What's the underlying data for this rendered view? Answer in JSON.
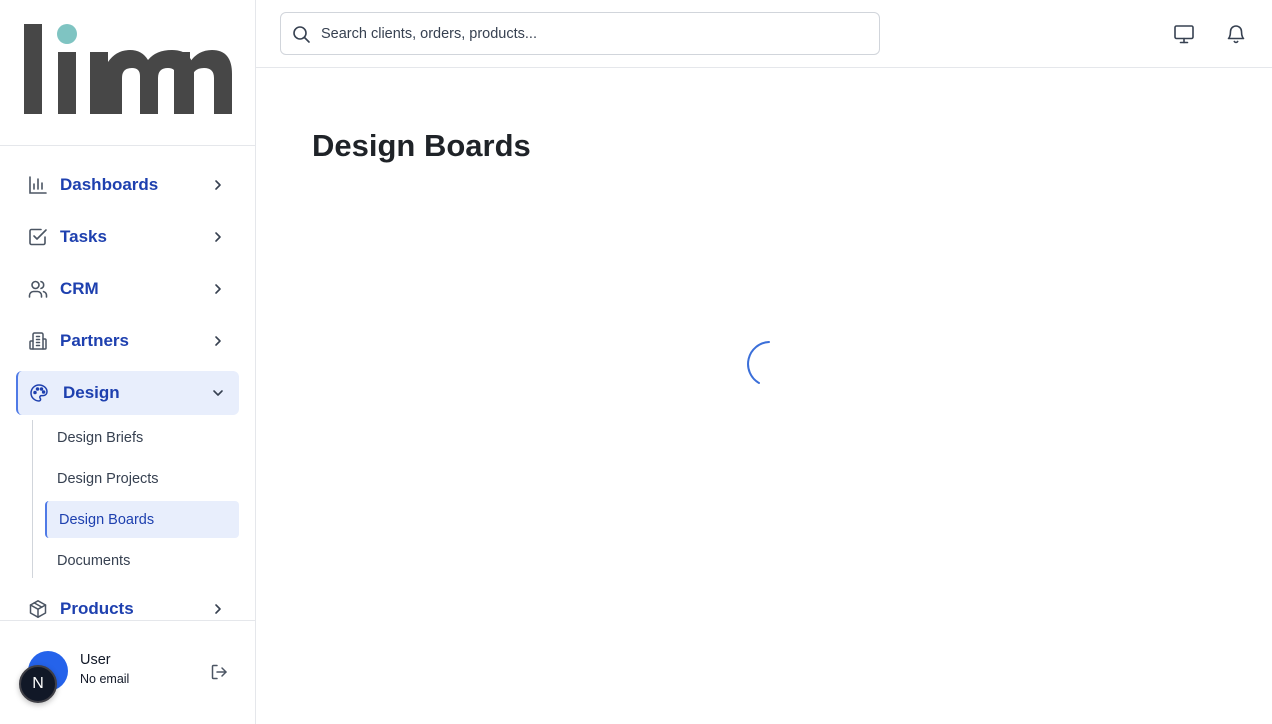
{
  "brand": {
    "logo_text": "limn",
    "logo_dot_color": "#7fc4c2",
    "logo_color": "#474747"
  },
  "colors": {
    "accent": "#1e40af",
    "active_bg": "#e8eefc",
    "active_border": "#4f7ae6",
    "avatar": "#2563eb"
  },
  "search": {
    "placeholder": "Search clients, orders, products..."
  },
  "sidebar": {
    "items": [
      {
        "label": "Dashboards",
        "icon": "bar-chart-icon",
        "expanded": false
      },
      {
        "label": "Tasks",
        "icon": "check-square-icon",
        "expanded": false
      },
      {
        "label": "CRM",
        "icon": "users-icon",
        "expanded": false
      },
      {
        "label": "Partners",
        "icon": "building-icon",
        "expanded": false
      },
      {
        "label": "Design",
        "icon": "palette-icon",
        "expanded": true
      },
      {
        "label": "Products",
        "icon": "package-icon",
        "expanded": false
      }
    ],
    "design_subitems": [
      {
        "label": "Design Briefs",
        "active": false
      },
      {
        "label": "Design Projects",
        "active": false
      },
      {
        "label": "Design Boards",
        "active": true
      },
      {
        "label": "Documents",
        "active": false
      }
    ]
  },
  "user": {
    "name": "User",
    "email": "No email",
    "badge": "N"
  },
  "topbar": {
    "icons": [
      "monitor-icon",
      "bell-icon"
    ]
  },
  "main": {
    "title": "Design Boards",
    "loading": true
  }
}
